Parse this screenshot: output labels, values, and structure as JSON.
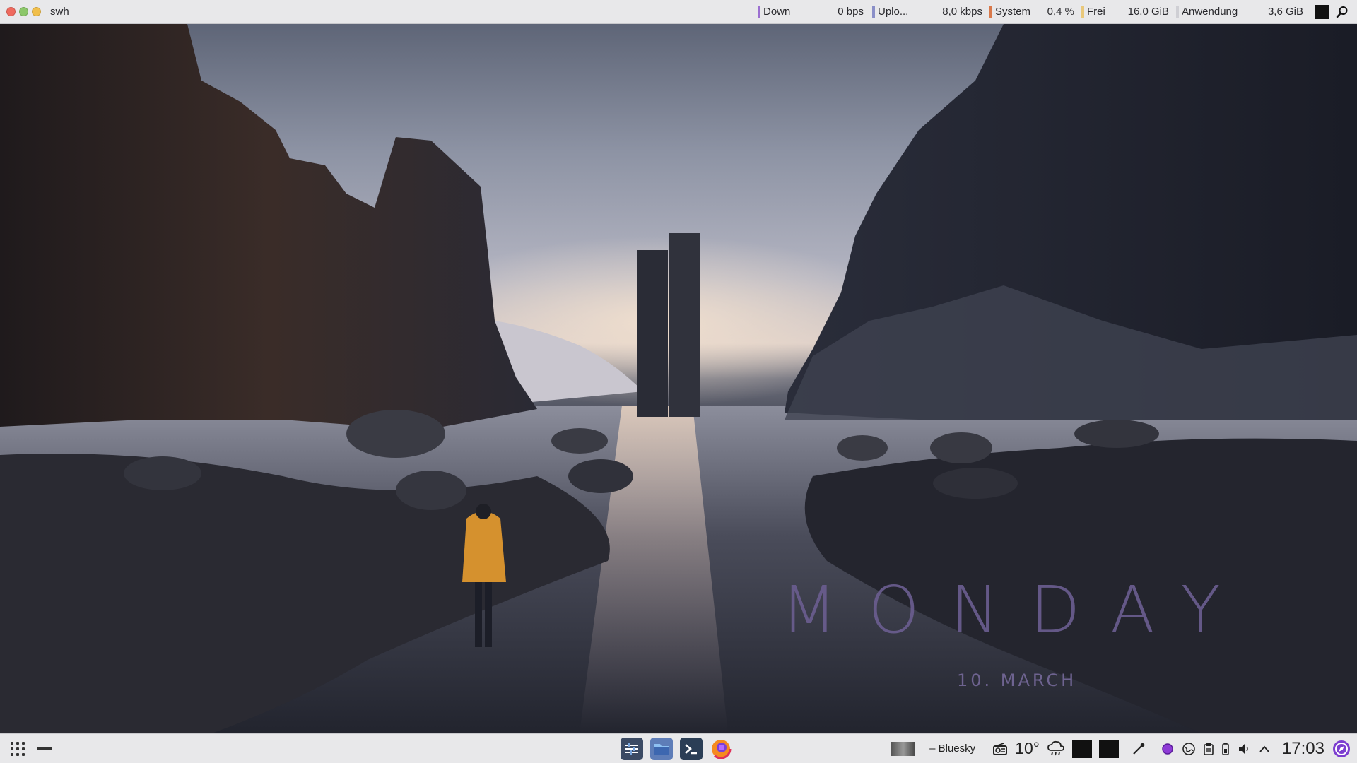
{
  "top_panel": {
    "window_title": "swh",
    "sysmon": [
      {
        "label": "Down",
        "value": "0 bps",
        "color": "#9b6fd1"
      },
      {
        "label": "Uplo...",
        "value": "8,0 kbps",
        "color": "#8a8fc8"
      },
      {
        "label": "System",
        "value": "0,4 %",
        "color": "#d9794b"
      },
      {
        "label": "Frei",
        "value": "16,0 GiB",
        "color": "#e9c87a"
      },
      {
        "label": "Anwendung",
        "value": "3,6 GiB",
        "color": "#cfcfd4"
      }
    ]
  },
  "wallpaper": {
    "day": "MONDAY",
    "date": "10. MARCH",
    "text_color": "#6a5d8f"
  },
  "bottom_panel": {
    "tasks": [
      {
        "name": "settings-app-icon"
      },
      {
        "name": "file-manager-icon"
      },
      {
        "name": "terminal-icon"
      },
      {
        "name": "firefox-icon"
      }
    ],
    "tray": {
      "media_title": "– Bluesky",
      "temperature": "10°",
      "clock": "17:03"
    }
  }
}
